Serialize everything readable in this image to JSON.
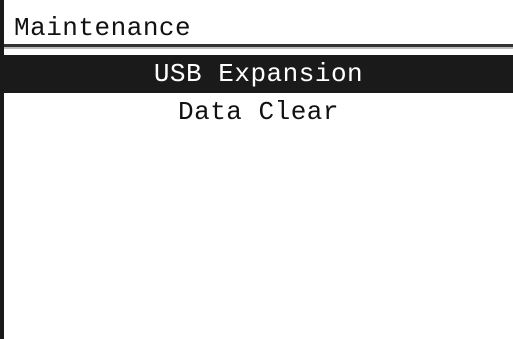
{
  "screen": {
    "title": "Maintenance"
  },
  "menu": {
    "items": [
      {
        "label": "USB Expansion",
        "selected": true
      },
      {
        "label": "Data Clear",
        "selected": false
      }
    ]
  }
}
